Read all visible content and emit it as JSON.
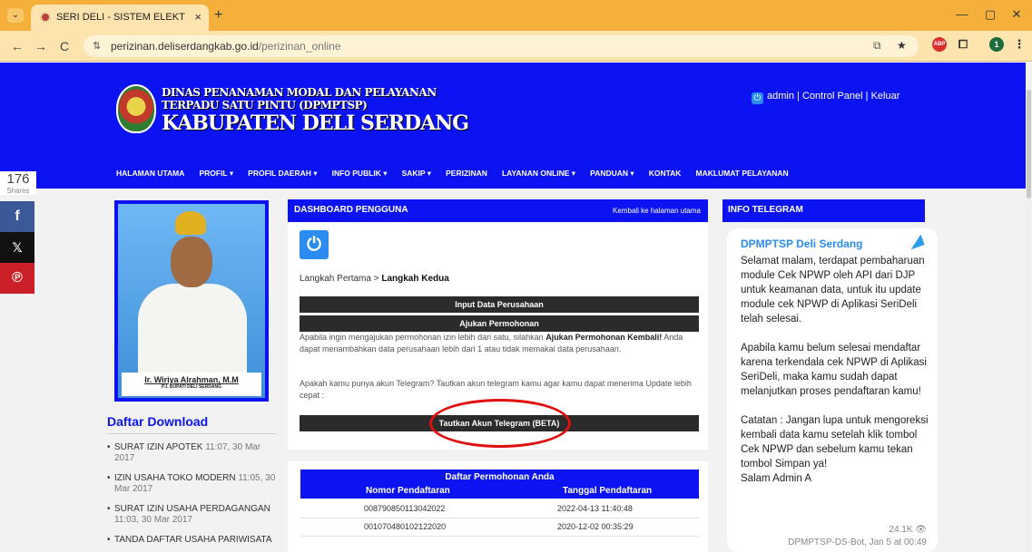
{
  "browser": {
    "tab_title": "SERI DELI - SISTEM ELEKTRONI",
    "url_host": "perizinan.deliserdangkab.go.id",
    "url_path": "/perizinan_online",
    "tab_close_glyph": "×",
    "new_tab_glyph": "+",
    "menu_glyph": "⌄",
    "back_glyph": "←",
    "forward_glyph": "→",
    "reload_glyph": "C",
    "site_info_glyph": "⇅",
    "minimize_glyph": "—",
    "restore_glyph": "▢",
    "window_close_glyph": "✕",
    "more_glyph": "⋮",
    "ext_abp": "ABP",
    "profile_initial": "1"
  },
  "header": {
    "logo_line1": "DINAS PENANAMAN MODAL DAN PELAYANAN",
    "logo_line2": "TERPADU SATU PINTU (DPMPTSP)",
    "logo_line3": "KABUPATEN DELI SERDANG",
    "user": "admin",
    "control_panel": "Control Panel",
    "logout": "Keluar",
    "separator": "|"
  },
  "nav": {
    "items": [
      "HALAMAN UTAMA",
      "PROFIL ▾",
      "PROFIL DAERAH ▾",
      "INFO PUBLIK ▾",
      "SAKIP ▾",
      "PERIZINAN",
      "LAYANAN ONLINE ▾",
      "PANDUAN ▾",
      "KONTAK",
      "MAKLUMAT PELAYANAN"
    ]
  },
  "share": {
    "count": "176",
    "label": "Shares",
    "facebook": "f",
    "x": "𝕏",
    "pinterest": "℗"
  },
  "profile": {
    "name": "Ir. Wiriya Alrahman, M.M",
    "title": "PJ. BUPATI DELI SERDANG"
  },
  "downloads": {
    "title": "Daftar Download",
    "items": [
      {
        "name": "SURAT IZIN APOTEK",
        "date": "11:07, 30 Mar 2017"
      },
      {
        "name": "IZIN USAHA TOKO MODERN",
        "date": "11:05, 30 Mar 2017"
      },
      {
        "name": "SURAT IZIN USAHA PERDAGANGAN",
        "date": "11:03, 30 Mar 2017"
      },
      {
        "name": "TANDA DAFTAR USAHA PARIWISATA",
        "date": ""
      }
    ]
  },
  "dashboard": {
    "title": "DASHBOARD PENGGUNA",
    "back_link": "Kembali ke halaman utama",
    "icon_glyph": "⏻",
    "step_first": "Langkah Pertama > ",
    "step_second": "Langkah Kedua",
    "btn_input": "Input Data Perusahaan",
    "btn_apply": "Ajukan Permohonan",
    "info_pre": "Apabila ingin mengajukan permohonan izin lebih dari satu, silahkan ",
    "info_bold": "Ajukan Permohonan Kembali!",
    "info_post": " Anda dapat menambahkan data perusahaan lebih dari 1 atau tidak memakai data perusahaan.",
    "telegram_question": "Apakah kamu punya akun Telegram? Tautkan akun telegram kamu agar kamu dapat menerima Update lebih cepat :",
    "btn_telegram": "Tautkan Akun Telegram (BETA)"
  },
  "applications": {
    "title": "Daftar Permohonan Anda",
    "col_number": "Nomor Pendaftaran",
    "col_date": "Tanggal Pendaftaran",
    "rows": [
      {
        "number": "008790850113042022",
        "date": "2022-04-13 11:40:48"
      },
      {
        "number": "001070480102122020",
        "date": "2020-12-02 00:35:29"
      }
    ]
  },
  "telegram": {
    "section_title": "INFO TELEGRAM",
    "channel": "DPMPTSP Deli Serdang",
    "para1": "Selamat malam, terdapat pembaharuan module Cek NPWP oleh API dari DJP untuk keamanan data, untuk itu update module cek NPWP di Aplikasi SeriDeli telah selesai.",
    "para2": "Apabila kamu belum selesai mendaftar karena terkendala cek NPWP di Aplikasi SeriDeli, maka kamu sudah dapat melanjutkan proses pendaftaran kamu!",
    "para3": "Catatan : Jangan lupa untuk mengoreksi kembali data kamu setelah klik tombol Cek NPWP dan sebelum kamu tekan tombol Simpan ya!",
    "signoff": "Salam Admin A",
    "views": "24.1K 👁",
    "footer": "DPMPTSP-DS-Bot, Jan 5 at 00:49"
  },
  "colors": {
    "brand_blue": "#0b14f0",
    "browser_orange": "#f4b03a",
    "highlight_red": "#e01010"
  }
}
